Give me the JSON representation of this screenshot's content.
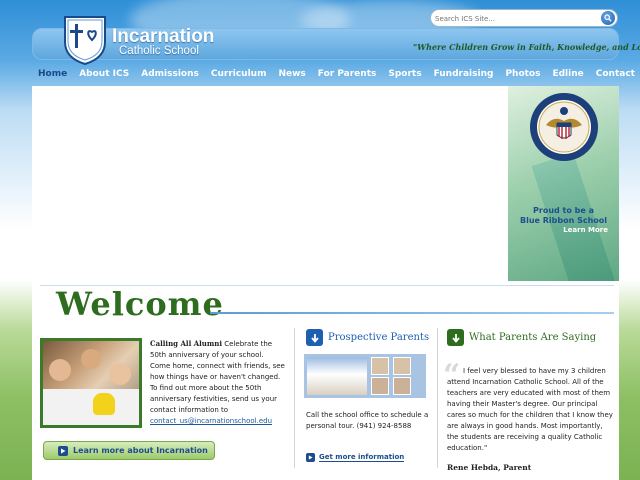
{
  "header": {
    "school_name": "Incarnation",
    "school_subtitle": "Catholic School",
    "tagline": "\"Where Children Grow in Faith, Knowledge, and Love\"",
    "search": {
      "placeholder": "Search ICS Site..."
    }
  },
  "nav": {
    "items": [
      "Home",
      "About ICS",
      "Admissions",
      "Curriculum",
      "News",
      "For Parents",
      "Sports",
      "Fundraising",
      "Photos",
      "Edline",
      "Contact"
    ],
    "active": "Home"
  },
  "banner": {
    "line1": "Proud to be a",
    "line2": "Blue Ribbon School",
    "learn_more": "Learn More"
  },
  "welcome": {
    "title": "Welcome"
  },
  "alumni": {
    "heading": "Calling All Alumni",
    "text_before_link": "Celebrate the 50th anniversary of your school. Come home, connect with friends, see how things have or haven't changed. To find out more about the 50th anniversary festivities, send us your contact information to",
    "email": "contact_us@incarnationschool.edu",
    "button_label": "Learn more about Incarnation"
  },
  "prospective": {
    "title": "Prospective Parents",
    "text": "Call the school office to schedule a personal tour.  (941) 924-8588",
    "link_label": "Get more information"
  },
  "parents_say": {
    "title": "What Parents Are Saying",
    "quote": "I feel very blessed to have my 3 children attend Incarnation Catholic School.  All of the teachers are very educated with most of them having their Master's degree.  Our principal cares so much for the children that I know they are always in good hands.  Most importantly, the students are receiving a quality Catholic education.\"",
    "author": "Rene Hebda, Parent"
  },
  "colors": {
    "nav_active": "#1a4a8a",
    "welcome_green": "#2e6d1f",
    "section_blue": "#1d5fb0",
    "section_green": "#2e6d1f"
  },
  "icons": {
    "logo": "cross-heart-shield-icon",
    "search": "magnifier-icon",
    "prospective": "down-arrow-icon",
    "parents": "down-arrow-icon",
    "play": "play-icon"
  }
}
